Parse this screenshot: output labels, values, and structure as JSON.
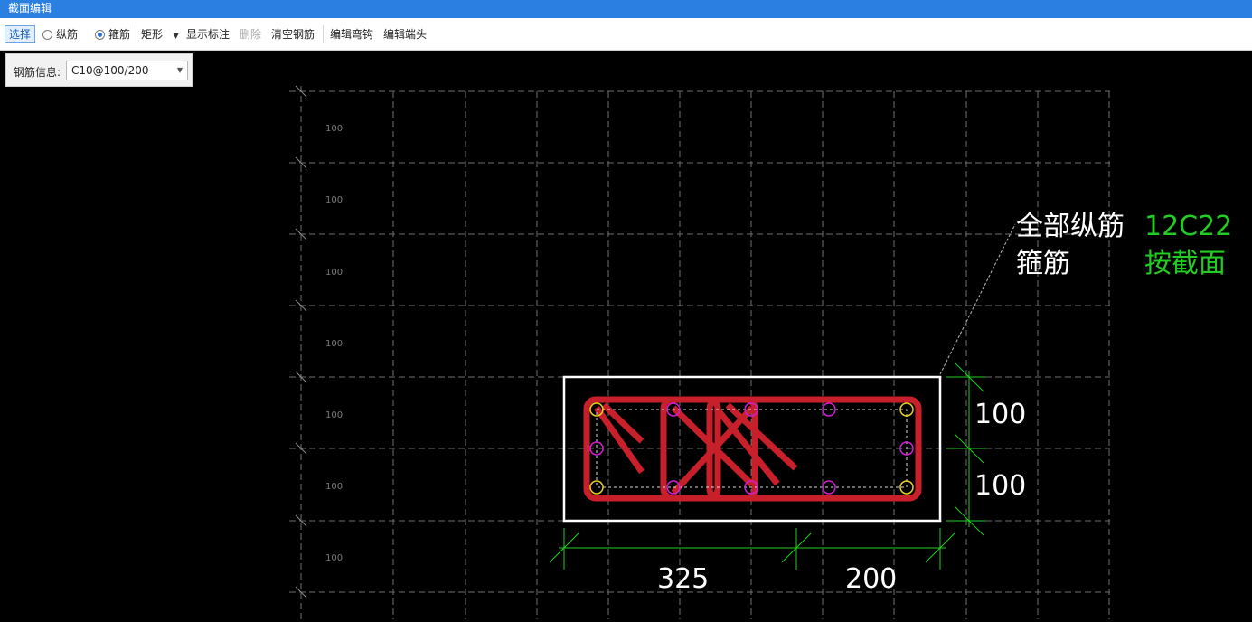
{
  "window": {
    "title": "截面编辑"
  },
  "toolbar": {
    "select_label": "选择",
    "longitudinal_label": "纵筋",
    "stirrup_label": "箍筋",
    "shape_value": "矩形",
    "show_annotation_label": "显示标注",
    "delete_label": "删除",
    "clear_rebar_label": "清空钢筋",
    "edit_hook_label": "编辑弯钩",
    "edit_end_label": "编辑端头",
    "selected_mode": "箍筋"
  },
  "rebar_info": {
    "label": "钢筋信息:",
    "value": "C10@100/200"
  },
  "grid": {
    "row_labels": [
      "100",
      "100",
      "100",
      "100",
      "100",
      "100",
      "100"
    ]
  },
  "dimensions": {
    "horizontal": [
      "325",
      "200"
    ],
    "vertical": [
      "100",
      "100"
    ]
  },
  "legend": {
    "all_longitudinal_label": "全部纵筋",
    "all_longitudinal_value": "12C22",
    "stirrup_label": "箍筋",
    "stirrup_value": "按截面"
  },
  "colors": {
    "titlebar": "#2b7fe0",
    "canvas_bg": "#000000",
    "stirrup": "#c8202a",
    "corner_bar": "#e6d21e",
    "side_bar": "#d21ed2",
    "dimension": "#22cc22",
    "legend_value": "#22cc22",
    "section_outline": "#ffffff"
  }
}
